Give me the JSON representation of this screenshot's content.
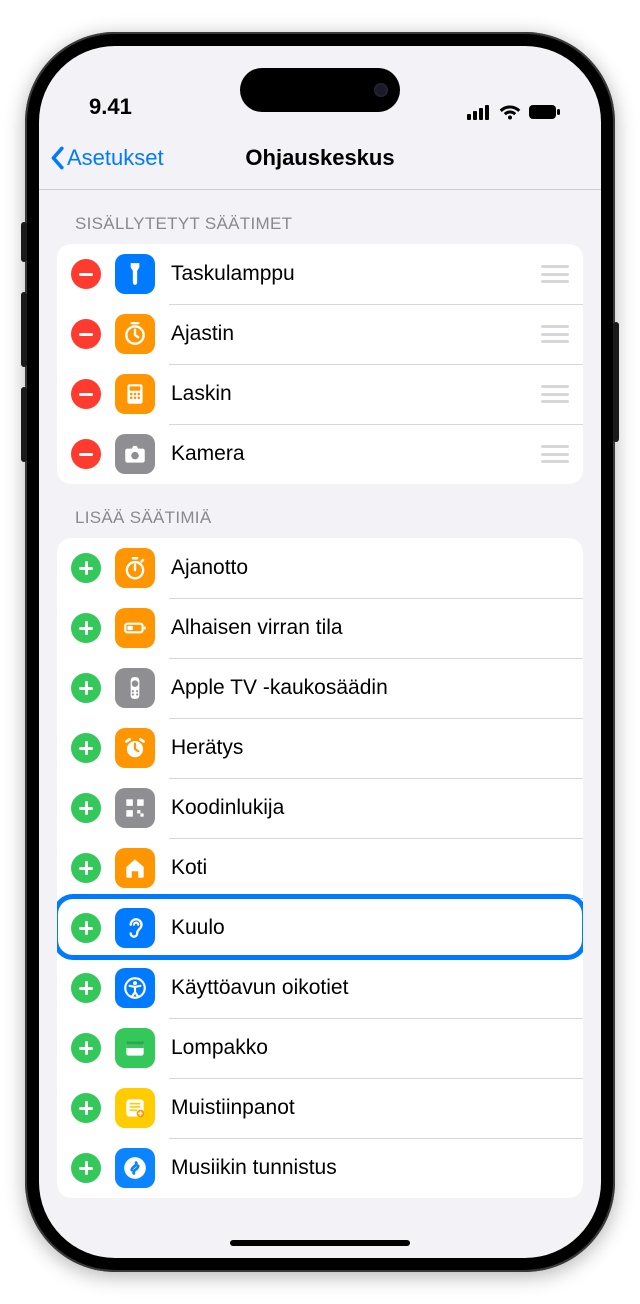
{
  "status": {
    "time": "9.41"
  },
  "nav": {
    "back": "Asetukset",
    "title": "Ohjauskeskus"
  },
  "sections": {
    "included_header": "SISÄLLYTETYT SÄÄTIMET",
    "more_header": "LISÄÄ SÄÄTIMIÄ"
  },
  "included": [
    {
      "id": "flashlight",
      "label": "Taskulamppu",
      "color": "#007aff"
    },
    {
      "id": "timer",
      "label": "Ajastin",
      "color": "#ff9500"
    },
    {
      "id": "calculator",
      "label": "Laskin",
      "color": "#ff9500"
    },
    {
      "id": "camera",
      "label": "Kamera",
      "color": "#8e8e93"
    }
  ],
  "more": [
    {
      "id": "stopwatch",
      "label": "Ajanotto",
      "color": "#ff9500"
    },
    {
      "id": "lowpower",
      "label": "Alhaisen virran tila",
      "color": "#ff9500"
    },
    {
      "id": "appletv",
      "label": "Apple TV -kaukosäädin",
      "color": "#8e8e93"
    },
    {
      "id": "alarm",
      "label": "Herätys",
      "color": "#ff9500"
    },
    {
      "id": "qrcode",
      "label": "Koodinlukija",
      "color": "#8e8e93"
    },
    {
      "id": "home",
      "label": "Koti",
      "color": "#ff9500"
    },
    {
      "id": "hearing",
      "label": "Kuulo",
      "color": "#007aff",
      "highlight": true
    },
    {
      "id": "a11y",
      "label": "Käyttöavun oikotiet",
      "color": "#007aff"
    },
    {
      "id": "wallet",
      "label": "Lompakko",
      "color": "#34c759"
    },
    {
      "id": "notes",
      "label": "Muistiinpanot",
      "color": "#ffcc00"
    },
    {
      "id": "shazam",
      "label": "Musiikin tunnistus",
      "color": "#0a84ff"
    }
  ]
}
